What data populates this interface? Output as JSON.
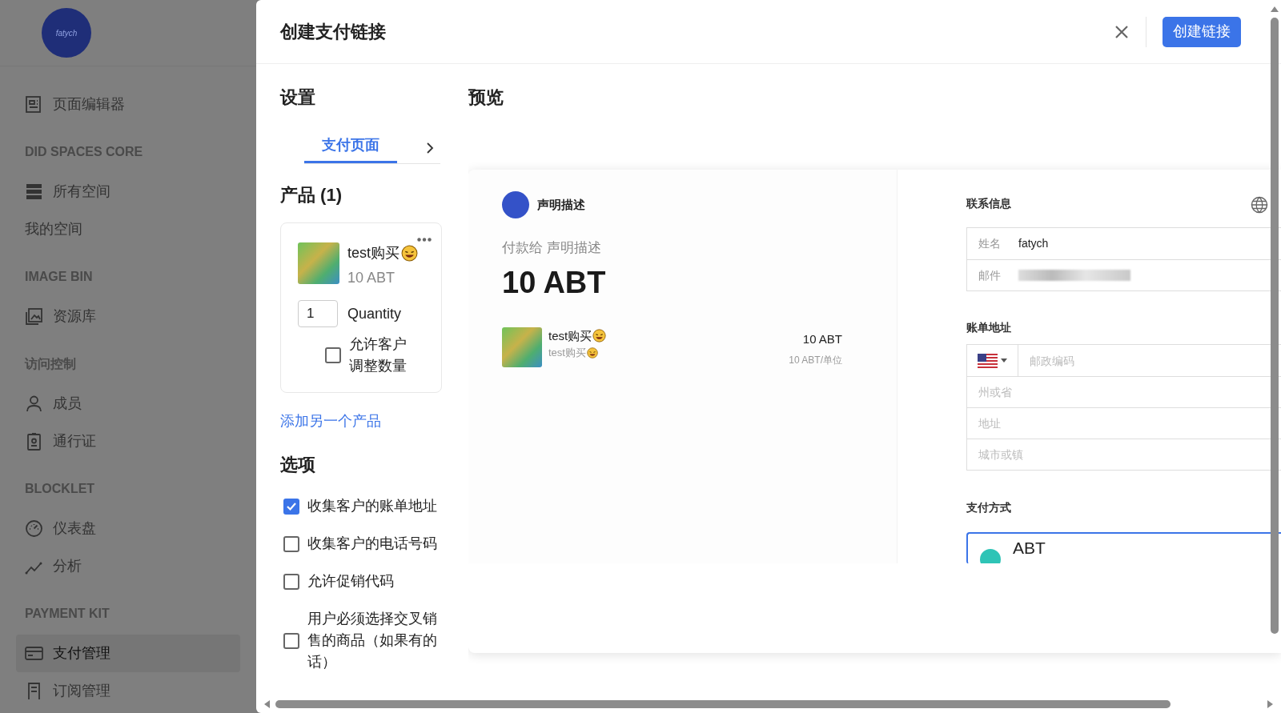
{
  "sidebar": {
    "avatar_text": "fatych",
    "items": [
      {
        "kind": "link",
        "label": "页面编辑器",
        "selected": false
      },
      {
        "kind": "section",
        "label": "DID SPACES CORE"
      },
      {
        "kind": "link",
        "label": "所有空间",
        "selected": false
      },
      {
        "kind": "plain",
        "label": "我的空间",
        "selected": false
      },
      {
        "kind": "section",
        "label": "IMAGE BIN"
      },
      {
        "kind": "link",
        "label": "资源库",
        "selected": false
      },
      {
        "kind": "section",
        "label": "访问控制"
      },
      {
        "kind": "link",
        "label": "成员",
        "selected": false
      },
      {
        "kind": "link",
        "label": "通行证",
        "selected": false
      },
      {
        "kind": "section",
        "label": "BLOCKLET"
      },
      {
        "kind": "link",
        "label": "仪表盘",
        "selected": false
      },
      {
        "kind": "link",
        "label": "分析",
        "selected": false
      },
      {
        "kind": "section",
        "label": "PAYMENT KIT"
      },
      {
        "kind": "link",
        "label": "支付管理",
        "selected": true
      },
      {
        "kind": "link",
        "label": "订阅管理",
        "selected": false
      }
    ]
  },
  "dialog": {
    "title": "创建支付链接",
    "create_button": "创建链接",
    "settings": {
      "heading": "设置",
      "tabs": [
        {
          "label": "支付页面",
          "selected": true
        }
      ],
      "products_heading": "产品 (1)",
      "products": [
        {
          "name": "test购买",
          "price": "10 ABT",
          "quantity": "1",
          "quantity_label": "Quantity",
          "adjust_label": "允许客户调整数量",
          "adjust_checked": false
        }
      ],
      "add_product_link": "添加另一个产品",
      "options_heading": "选项",
      "options": [
        {
          "label": "收集客户的账单地址",
          "checked": true
        },
        {
          "label": "收集客户的电话号码",
          "checked": false
        },
        {
          "label": "允许促销代码",
          "checked": false
        },
        {
          "label": "用户必须选择交叉销售的商品（如果有的话）",
          "checked": false
        }
      ]
    },
    "preview": {
      "heading": "预览",
      "brand": "声明描述",
      "pay_to": "付款给 声明描述",
      "amount": "10 ABT",
      "line_items": [
        {
          "name": "test购买",
          "subtitle": "test购买",
          "price": "10 ABT",
          "unit_price": "10 ABT/单位"
        }
      ],
      "contact_heading": "联系信息",
      "contact_fields": [
        {
          "label": "姓名",
          "value": "fatych"
        },
        {
          "label": "邮件",
          "value_blurred": true
        }
      ],
      "billing_heading": "账单地址",
      "billing_fields": [
        {
          "kind": "country_postal",
          "placeholder": "邮政编码"
        },
        {
          "kind": "text",
          "placeholder": "州或省"
        },
        {
          "kind": "text",
          "placeholder": "地址"
        },
        {
          "kind": "text",
          "placeholder": "城市或镇"
        }
      ],
      "payment_heading": "支付方式",
      "payment_methods": [
        {
          "label": "ABT",
          "selected": true
        }
      ]
    }
  }
}
